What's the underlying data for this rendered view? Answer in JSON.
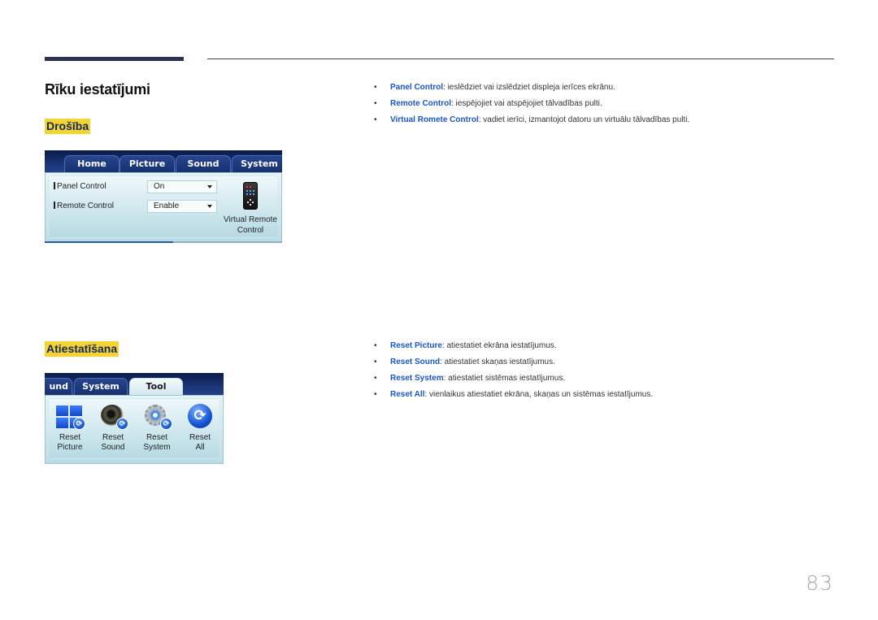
{
  "page": {
    "title": "Rīku iestatījumi",
    "number": "83"
  },
  "sections": {
    "security": {
      "heading": "Drošība",
      "panel": {
        "tabs": [
          "Home",
          "Picture",
          "Sound",
          "System"
        ],
        "rows": [
          {
            "label": "Panel Control",
            "value": "On"
          },
          {
            "label": "Remote Control",
            "value": "Enable"
          }
        ],
        "virtual_remote_caption": "Virtual Remote Control"
      },
      "bullets": [
        {
          "term": "Panel Control",
          "desc": ": ieslēdziet vai izslēdziet displeja ierīces ekrānu."
        },
        {
          "term": "Remote Control",
          "desc": ": iespējojiet vai atspējojiet tālvadības pulti."
        },
        {
          "term": "Virtual Romete Control",
          "desc": ": vadiet ierīci, izmantojot datoru un virtuālu tālvadības pulti."
        }
      ]
    },
    "reset": {
      "heading": "Atiestatīšana",
      "panel": {
        "tabs": [
          "und",
          "System",
          "Tool"
        ],
        "active_tab": "Tool",
        "items": [
          {
            "icon": "reset-picture-icon",
            "caption_line1": "Reset",
            "caption_line2": "Picture"
          },
          {
            "icon": "reset-sound-icon",
            "caption_line1": "Reset",
            "caption_line2": "Sound"
          },
          {
            "icon": "reset-system-icon",
            "caption_line1": "Reset",
            "caption_line2": "System"
          },
          {
            "icon": "reset-all-icon",
            "caption_line1": "Reset",
            "caption_line2": "All"
          }
        ]
      },
      "bullets": [
        {
          "term": "Reset Picture",
          "desc": ": atiestatiet ekrāna iestatījumus."
        },
        {
          "term": "Reset Sound",
          "desc": ": atiestatiet skaņas iestatījumus."
        },
        {
          "term": "Reset System",
          "desc": ": atiestatiet sistēmas iestatījumus."
        },
        {
          "term": "Reset All",
          "desc": ": vienlaikus atiestatiet ekrāna, skaņas un sistēmas iestatījumus."
        }
      ]
    }
  },
  "colors": {
    "accent_blue": "#1a56c8",
    "highlight_yellow": "#f2d432",
    "rule_navy": "#2c3350"
  }
}
